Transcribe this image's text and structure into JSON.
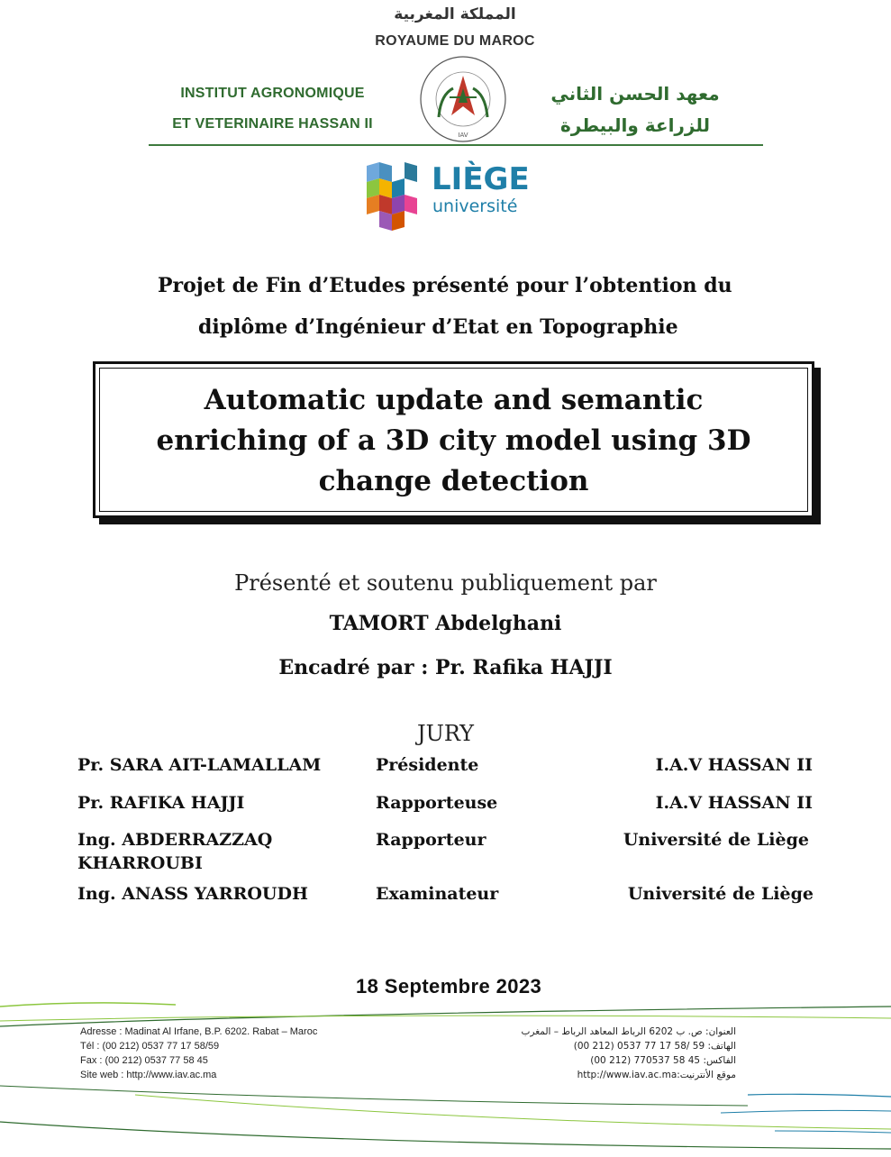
{
  "header": {
    "kingdom_ar": "المملكة المغربية",
    "kingdom_fr": "Royaume du Maroc",
    "institute_line1": "Institut Agronomique",
    "institute_line2": "et Veterinaire Hassan II",
    "institute_ar_line1": "معهد الحسن الثاني",
    "institute_ar_line2": "للزراعة والبيطرة",
    "seal_text": "Institut Agronomique et Vétérinaire Hassan II",
    "seal_center": "IAV",
    "liege_logo_line1": "LIÈGE",
    "liege_logo_line2": "université"
  },
  "project": {
    "line1": "Projet de Fin d’Etudes présenté pour l’obtention du",
    "line2": "diplôme d’Ingénieur d’Etat en Topographie"
  },
  "title": {
    "line1": "Automatic update and semantic",
    "line2": "enriching of a 3D city model using 3D",
    "line3": "change detection"
  },
  "presented": {
    "intro": "Présenté et soutenu publiquement par",
    "author": "TAMORT Abdelghani",
    "supervisor": "Encadré par : Pr. Rafika HAJJI"
  },
  "jury": {
    "heading": "JURY",
    "members": [
      {
        "name": "Pr. SARA AIT-LAMALLAM",
        "role": "Présidente",
        "institution": "I.A.V HASSAN II"
      },
      {
        "name": "Pr. RAFIKA HAJJI",
        "role": "Rapporteuse",
        "institution": "I.A.V HASSAN II"
      },
      {
        "name": "Ing. ABDERRAZZAQ",
        "name_cont": "KHARROUBI",
        "role": "Rapporteur",
        "institution": "Université de Liège"
      },
      {
        "name": "Ing. ANASS YARROUDH",
        "role": "Examinateur",
        "institution": "Université de Liège"
      }
    ]
  },
  "date": "18 Septembre 2023",
  "footer": {
    "address": "Adresse : Madinat Al Irfane, B.P. 6202. Rabat – Maroc",
    "tel": "Tél : (00 212) 0537 77 17 58/59",
    "fax": "Fax :  (00 212)  0537 77 58 45",
    "web": "Site web : http://www.iav.ac.ma",
    "address_ar": "العنوان: ص. ب   6202  الرباط المعاهد  الرباط – المغرب",
    "tel_ar": "الهاتف: 59 /58 17 77 0537 (212 00)",
    "fax_ar": "الفاكس:     45 58 770537 (212 00)",
    "web_ar": "موقع الأنترنيت:http://www.iav.ac.ma"
  },
  "colors": {
    "green": "#2f6b2f",
    "red": "#c0392b",
    "liege_blue": "#1f7fa8"
  }
}
